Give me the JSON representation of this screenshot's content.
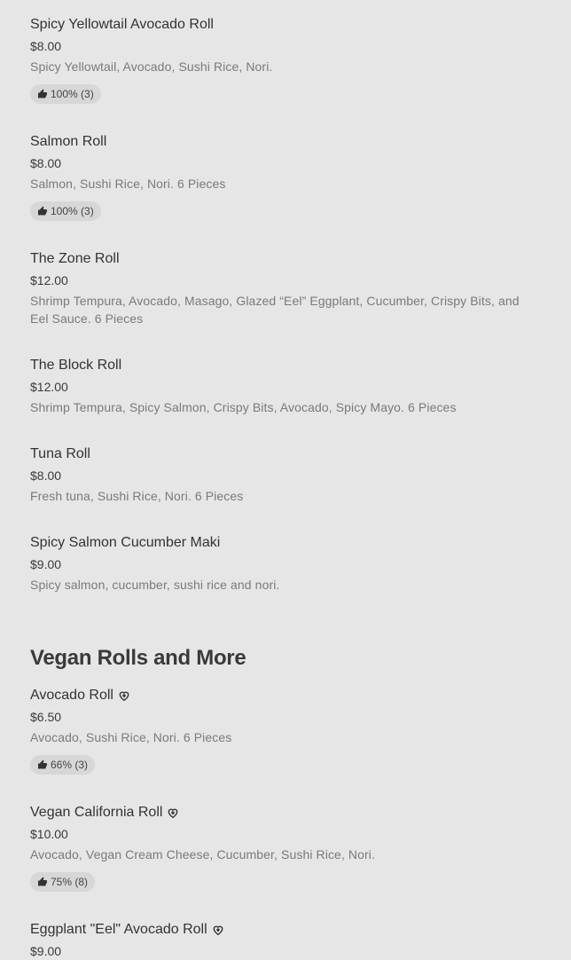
{
  "section_vegan_title": "Vegan Rolls and More",
  "items": [
    {
      "name": "Spicy Yellowtail Avocado Roll",
      "price": "$8.00",
      "desc": "Spicy Yellowtail, Avocado, Sushi Rice, Nori.",
      "rating": "100% (3)"
    },
    {
      "name": "Salmon Roll",
      "price": "$8.00",
      "desc": "Salmon, Sushi Rice, Nori. 6 Pieces",
      "rating": "100% (3)"
    },
    {
      "name": "The Zone Roll",
      "price": "$12.00",
      "desc": "Shrimp Tempura, Avocado, Masago, Glazed “Eel” Eggplant, Cucumber, Crispy Bits, and Eel Sauce. 6 Pieces"
    },
    {
      "name": "The Block Roll",
      "price": "$12.00",
      "desc": "Shrimp Tempura, Spicy Salmon, Crispy Bits, Avocado, Spicy Mayo. 6 Pieces"
    },
    {
      "name": "Tuna Roll",
      "price": "$8.00",
      "desc": "Fresh tuna, Sushi Rice, Nori. 6 Pieces"
    },
    {
      "name": "Spicy Salmon Cucumber Maki",
      "price": "$9.00",
      "desc": "Spicy salmon, cucumber, sushi rice and nori."
    }
  ],
  "vegan_items": [
    {
      "name": "Avocado Roll",
      "price": "$6.50",
      "desc": "Avocado, Sushi Rice, Nori. 6 Pieces",
      "rating": "66% (3)"
    },
    {
      "name": "Vegan California Roll",
      "price": "$10.00",
      "desc": "Avocado, Vegan Cream Cheese, Cucumber, Sushi Rice, Nori.",
      "rating": "75% (8)"
    },
    {
      "name": "Eggplant \"Eel\" Avocado Roll",
      "price": "$9.00"
    }
  ],
  "icons": {
    "rating": "thumbs-up-icon",
    "vegan": "heart-leaf-icon"
  },
  "colors": {
    "background": "#e6e6e6",
    "badge": "#d7d7d7",
    "text": "#333333",
    "muted": "#7a7a7a"
  }
}
